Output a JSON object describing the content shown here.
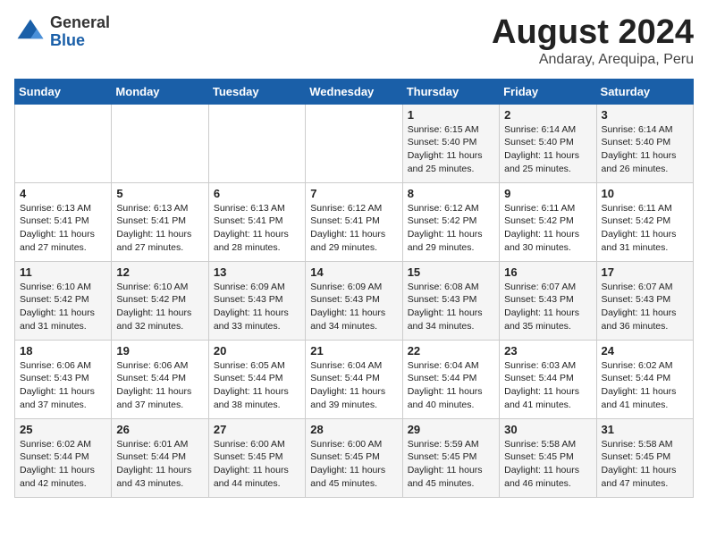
{
  "header": {
    "logo_general": "General",
    "logo_blue": "Blue",
    "month_title": "August 2024",
    "location": "Andaray, Arequipa, Peru"
  },
  "calendar": {
    "days_of_week": [
      "Sunday",
      "Monday",
      "Tuesday",
      "Wednesday",
      "Thursday",
      "Friday",
      "Saturday"
    ],
    "weeks": [
      [
        {
          "day": "",
          "info": ""
        },
        {
          "day": "",
          "info": ""
        },
        {
          "day": "",
          "info": ""
        },
        {
          "day": "",
          "info": ""
        },
        {
          "day": "1",
          "info": "Sunrise: 6:15 AM\nSunset: 5:40 PM\nDaylight: 11 hours\nand 25 minutes."
        },
        {
          "day": "2",
          "info": "Sunrise: 6:14 AM\nSunset: 5:40 PM\nDaylight: 11 hours\nand 25 minutes."
        },
        {
          "day": "3",
          "info": "Sunrise: 6:14 AM\nSunset: 5:40 PM\nDaylight: 11 hours\nand 26 minutes."
        }
      ],
      [
        {
          "day": "4",
          "info": "Sunrise: 6:13 AM\nSunset: 5:41 PM\nDaylight: 11 hours\nand 27 minutes."
        },
        {
          "day": "5",
          "info": "Sunrise: 6:13 AM\nSunset: 5:41 PM\nDaylight: 11 hours\nand 27 minutes."
        },
        {
          "day": "6",
          "info": "Sunrise: 6:13 AM\nSunset: 5:41 PM\nDaylight: 11 hours\nand 28 minutes."
        },
        {
          "day": "7",
          "info": "Sunrise: 6:12 AM\nSunset: 5:41 PM\nDaylight: 11 hours\nand 29 minutes."
        },
        {
          "day": "8",
          "info": "Sunrise: 6:12 AM\nSunset: 5:42 PM\nDaylight: 11 hours\nand 29 minutes."
        },
        {
          "day": "9",
          "info": "Sunrise: 6:11 AM\nSunset: 5:42 PM\nDaylight: 11 hours\nand 30 minutes."
        },
        {
          "day": "10",
          "info": "Sunrise: 6:11 AM\nSunset: 5:42 PM\nDaylight: 11 hours\nand 31 minutes."
        }
      ],
      [
        {
          "day": "11",
          "info": "Sunrise: 6:10 AM\nSunset: 5:42 PM\nDaylight: 11 hours\nand 31 minutes."
        },
        {
          "day": "12",
          "info": "Sunrise: 6:10 AM\nSunset: 5:42 PM\nDaylight: 11 hours\nand 32 minutes."
        },
        {
          "day": "13",
          "info": "Sunrise: 6:09 AM\nSunset: 5:43 PM\nDaylight: 11 hours\nand 33 minutes."
        },
        {
          "day": "14",
          "info": "Sunrise: 6:09 AM\nSunset: 5:43 PM\nDaylight: 11 hours\nand 34 minutes."
        },
        {
          "day": "15",
          "info": "Sunrise: 6:08 AM\nSunset: 5:43 PM\nDaylight: 11 hours\nand 34 minutes."
        },
        {
          "day": "16",
          "info": "Sunrise: 6:07 AM\nSunset: 5:43 PM\nDaylight: 11 hours\nand 35 minutes."
        },
        {
          "day": "17",
          "info": "Sunrise: 6:07 AM\nSunset: 5:43 PM\nDaylight: 11 hours\nand 36 minutes."
        }
      ],
      [
        {
          "day": "18",
          "info": "Sunrise: 6:06 AM\nSunset: 5:43 PM\nDaylight: 11 hours\nand 37 minutes."
        },
        {
          "day": "19",
          "info": "Sunrise: 6:06 AM\nSunset: 5:44 PM\nDaylight: 11 hours\nand 37 minutes."
        },
        {
          "day": "20",
          "info": "Sunrise: 6:05 AM\nSunset: 5:44 PM\nDaylight: 11 hours\nand 38 minutes."
        },
        {
          "day": "21",
          "info": "Sunrise: 6:04 AM\nSunset: 5:44 PM\nDaylight: 11 hours\nand 39 minutes."
        },
        {
          "day": "22",
          "info": "Sunrise: 6:04 AM\nSunset: 5:44 PM\nDaylight: 11 hours\nand 40 minutes."
        },
        {
          "day": "23",
          "info": "Sunrise: 6:03 AM\nSunset: 5:44 PM\nDaylight: 11 hours\nand 41 minutes."
        },
        {
          "day": "24",
          "info": "Sunrise: 6:02 AM\nSunset: 5:44 PM\nDaylight: 11 hours\nand 41 minutes."
        }
      ],
      [
        {
          "day": "25",
          "info": "Sunrise: 6:02 AM\nSunset: 5:44 PM\nDaylight: 11 hours\nand 42 minutes."
        },
        {
          "day": "26",
          "info": "Sunrise: 6:01 AM\nSunset: 5:44 PM\nDaylight: 11 hours\nand 43 minutes."
        },
        {
          "day": "27",
          "info": "Sunrise: 6:00 AM\nSunset: 5:45 PM\nDaylight: 11 hours\nand 44 minutes."
        },
        {
          "day": "28",
          "info": "Sunrise: 6:00 AM\nSunset: 5:45 PM\nDaylight: 11 hours\nand 45 minutes."
        },
        {
          "day": "29",
          "info": "Sunrise: 5:59 AM\nSunset: 5:45 PM\nDaylight: 11 hours\nand 45 minutes."
        },
        {
          "day": "30",
          "info": "Sunrise: 5:58 AM\nSunset: 5:45 PM\nDaylight: 11 hours\nand 46 minutes."
        },
        {
          "day": "31",
          "info": "Sunrise: 5:58 AM\nSunset: 5:45 PM\nDaylight: 11 hours\nand 47 minutes."
        }
      ]
    ]
  }
}
